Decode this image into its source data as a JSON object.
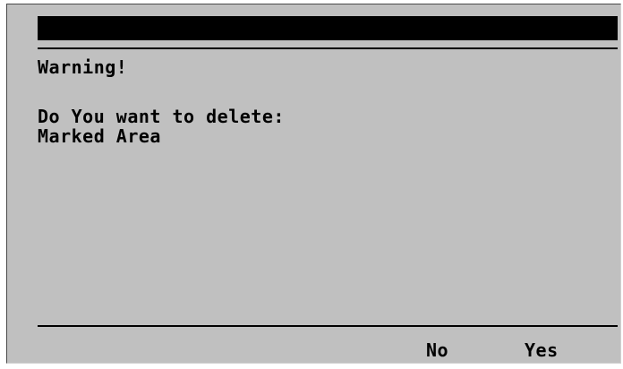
{
  "dialog": {
    "heading": "Warning!",
    "question": "Do You want to delete:",
    "item": "Marked Area"
  },
  "softkeys": {
    "no_label": "No",
    "yes_label": "Yes"
  },
  "colors": {
    "screen_background": "#c0c0c0",
    "title_bar": "#000000",
    "text": "#000000"
  }
}
